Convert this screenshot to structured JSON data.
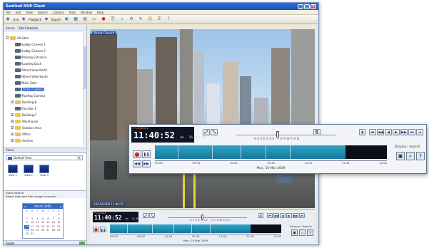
{
  "window": {
    "title": "Sentinel NVR Client",
    "menu": [
      "File",
      "Edit",
      "View",
      "Search",
      "Camera",
      "Tools",
      "Window",
      "Help"
    ]
  },
  "toolbar": {
    "text_buttons": [
      "Live",
      "Playback",
      "Export"
    ],
    "icons": [
      "camera-icon",
      "layout-icon",
      "grid-icon",
      "monitor-icon",
      "record-icon",
      "snapshot-icon",
      "search-icon",
      "settings-icon",
      "refresh-icon",
      "user-icon",
      "lock-icon",
      "help-icon"
    ]
  },
  "address": {
    "label": "Server",
    "value": "Site Cameras"
  },
  "tree": {
    "root_label": "All Sites",
    "items": [
      {
        "label": "Lobby Camera 1",
        "type": "cam"
      },
      {
        "label": "Lobby Camera 2",
        "type": "cam"
      },
      {
        "label": "Parking Entrance",
        "type": "cam"
      },
      {
        "label": "Loading Dock",
        "type": "cam"
      },
      {
        "label": "Street View North",
        "type": "cam"
      },
      {
        "label": "Street View South",
        "type": "cam"
      },
      {
        "label": "Main Gate",
        "type": "cam"
      },
      {
        "label": "Street Camera",
        "type": "cam",
        "selected": true
      },
      {
        "label": "Rooftop Camera",
        "type": "cam"
      },
      {
        "label": "Building B",
        "type": "folder"
      },
      {
        "label": "Corridor 1",
        "type": "cam"
      },
      {
        "label": "Building C",
        "type": "folder"
      },
      {
        "label": "Warehouse",
        "type": "folder"
      },
      {
        "label": "Outdoor Area",
        "type": "folder"
      },
      {
        "label": "Office",
        "type": "folder"
      },
      {
        "label": "Archive",
        "type": "folder"
      }
    ]
  },
  "views": {
    "header": "Views",
    "selected": "Default View",
    "thumbs": [
      "View 1",
      "View 2",
      "View 3"
    ]
  },
  "search": {
    "header": "Event Search",
    "note": "Select date and time range to search"
  },
  "calendar": {
    "month": "March 2009",
    "days_header": [
      "S",
      "M",
      "T",
      "W",
      "T",
      "F",
      "S"
    ],
    "days": [
      "",
      "",
      "",
      "",
      "",
      "",
      "1",
      "2",
      "3",
      "4",
      "5",
      "6",
      "7",
      "8",
      "9",
      "10",
      "11",
      "12",
      "13",
      "14",
      "15",
      "16",
      "17",
      "18",
      "19",
      "20",
      "21",
      "22",
      "23",
      "24",
      "25",
      "26",
      "27",
      "28",
      "29",
      "30",
      "31"
    ],
    "selected_day": "16",
    "footer": "Today: 03/16/2009"
  },
  "status": {
    "text": "Ready"
  },
  "video": {
    "camera_label": "Street Camera",
    "timestamp_label": "03/16/2009 11:40:52"
  },
  "playback": {
    "mode": "Playback",
    "time": "11:40:52",
    "ampm": "am",
    "date": "16-Mar-09",
    "speed_label": "REVERSE  FORWARD",
    "timeline_ticks": [
      "09:00",
      "09:30",
      "10:00",
      "10:30",
      "11:00",
      "11:30",
      "12:00"
    ],
    "date_caption": "Mon, 16 Mar 2009",
    "display_search_label": "Display / Search",
    "progress": 0.82
  },
  "colors": {
    "accent": "#2d69c9",
    "timeline": "#2ea2c2",
    "record": "#d22222"
  }
}
